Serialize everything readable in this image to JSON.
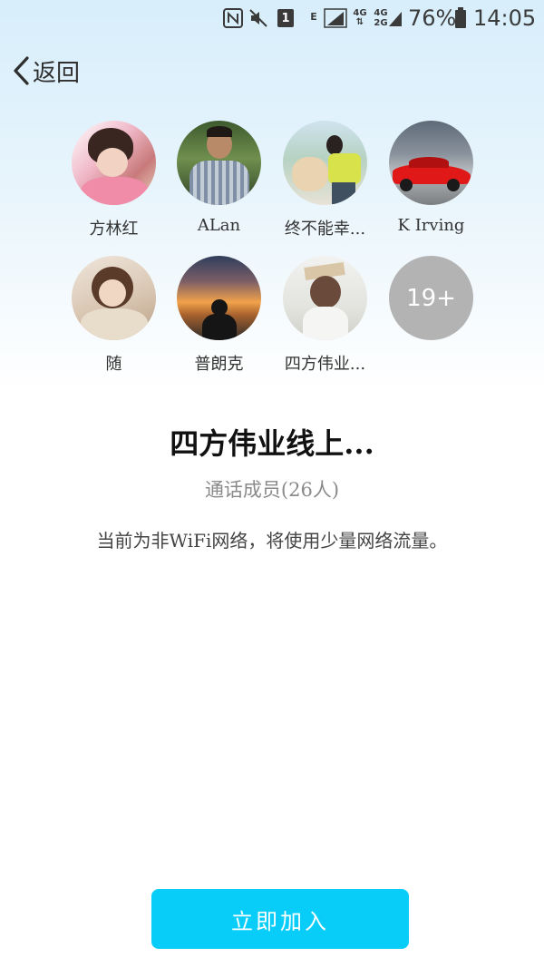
{
  "status_bar": {
    "battery": "76%",
    "time": "14:05",
    "sim_slot": "1",
    "signal_label_1": "E",
    "net_4g_a": "4G",
    "net_4g_b": "4G",
    "net_2g": "2G",
    "icons": [
      "nfc-icon",
      "mute-icon",
      "sim-icon",
      "signal-icon",
      "network-icon",
      "battery-icon"
    ]
  },
  "header": {
    "back_label": "返回"
  },
  "members": [
    {
      "name": "方林红",
      "avatar": "photo"
    },
    {
      "name": "ALan",
      "avatar": "photo"
    },
    {
      "name": "终不能幸...",
      "avatar": "photo"
    },
    {
      "name": "K   Irving",
      "avatar": "photo"
    },
    {
      "name": "随",
      "avatar": "photo"
    },
    {
      "name": "普朗克",
      "avatar": "photo"
    },
    {
      "name": "四方伟业...",
      "avatar": "photo"
    }
  ],
  "more_count": "19+",
  "group_title": "四方伟业线上...",
  "members_count_text": "通话成员(26人)",
  "network_notice": "当前为非WiFi网络，将使用少量网络流量。",
  "join_button": "立即加入",
  "colors": {
    "accent": "#08cdf9",
    "more_bg": "#b3b3b3"
  }
}
